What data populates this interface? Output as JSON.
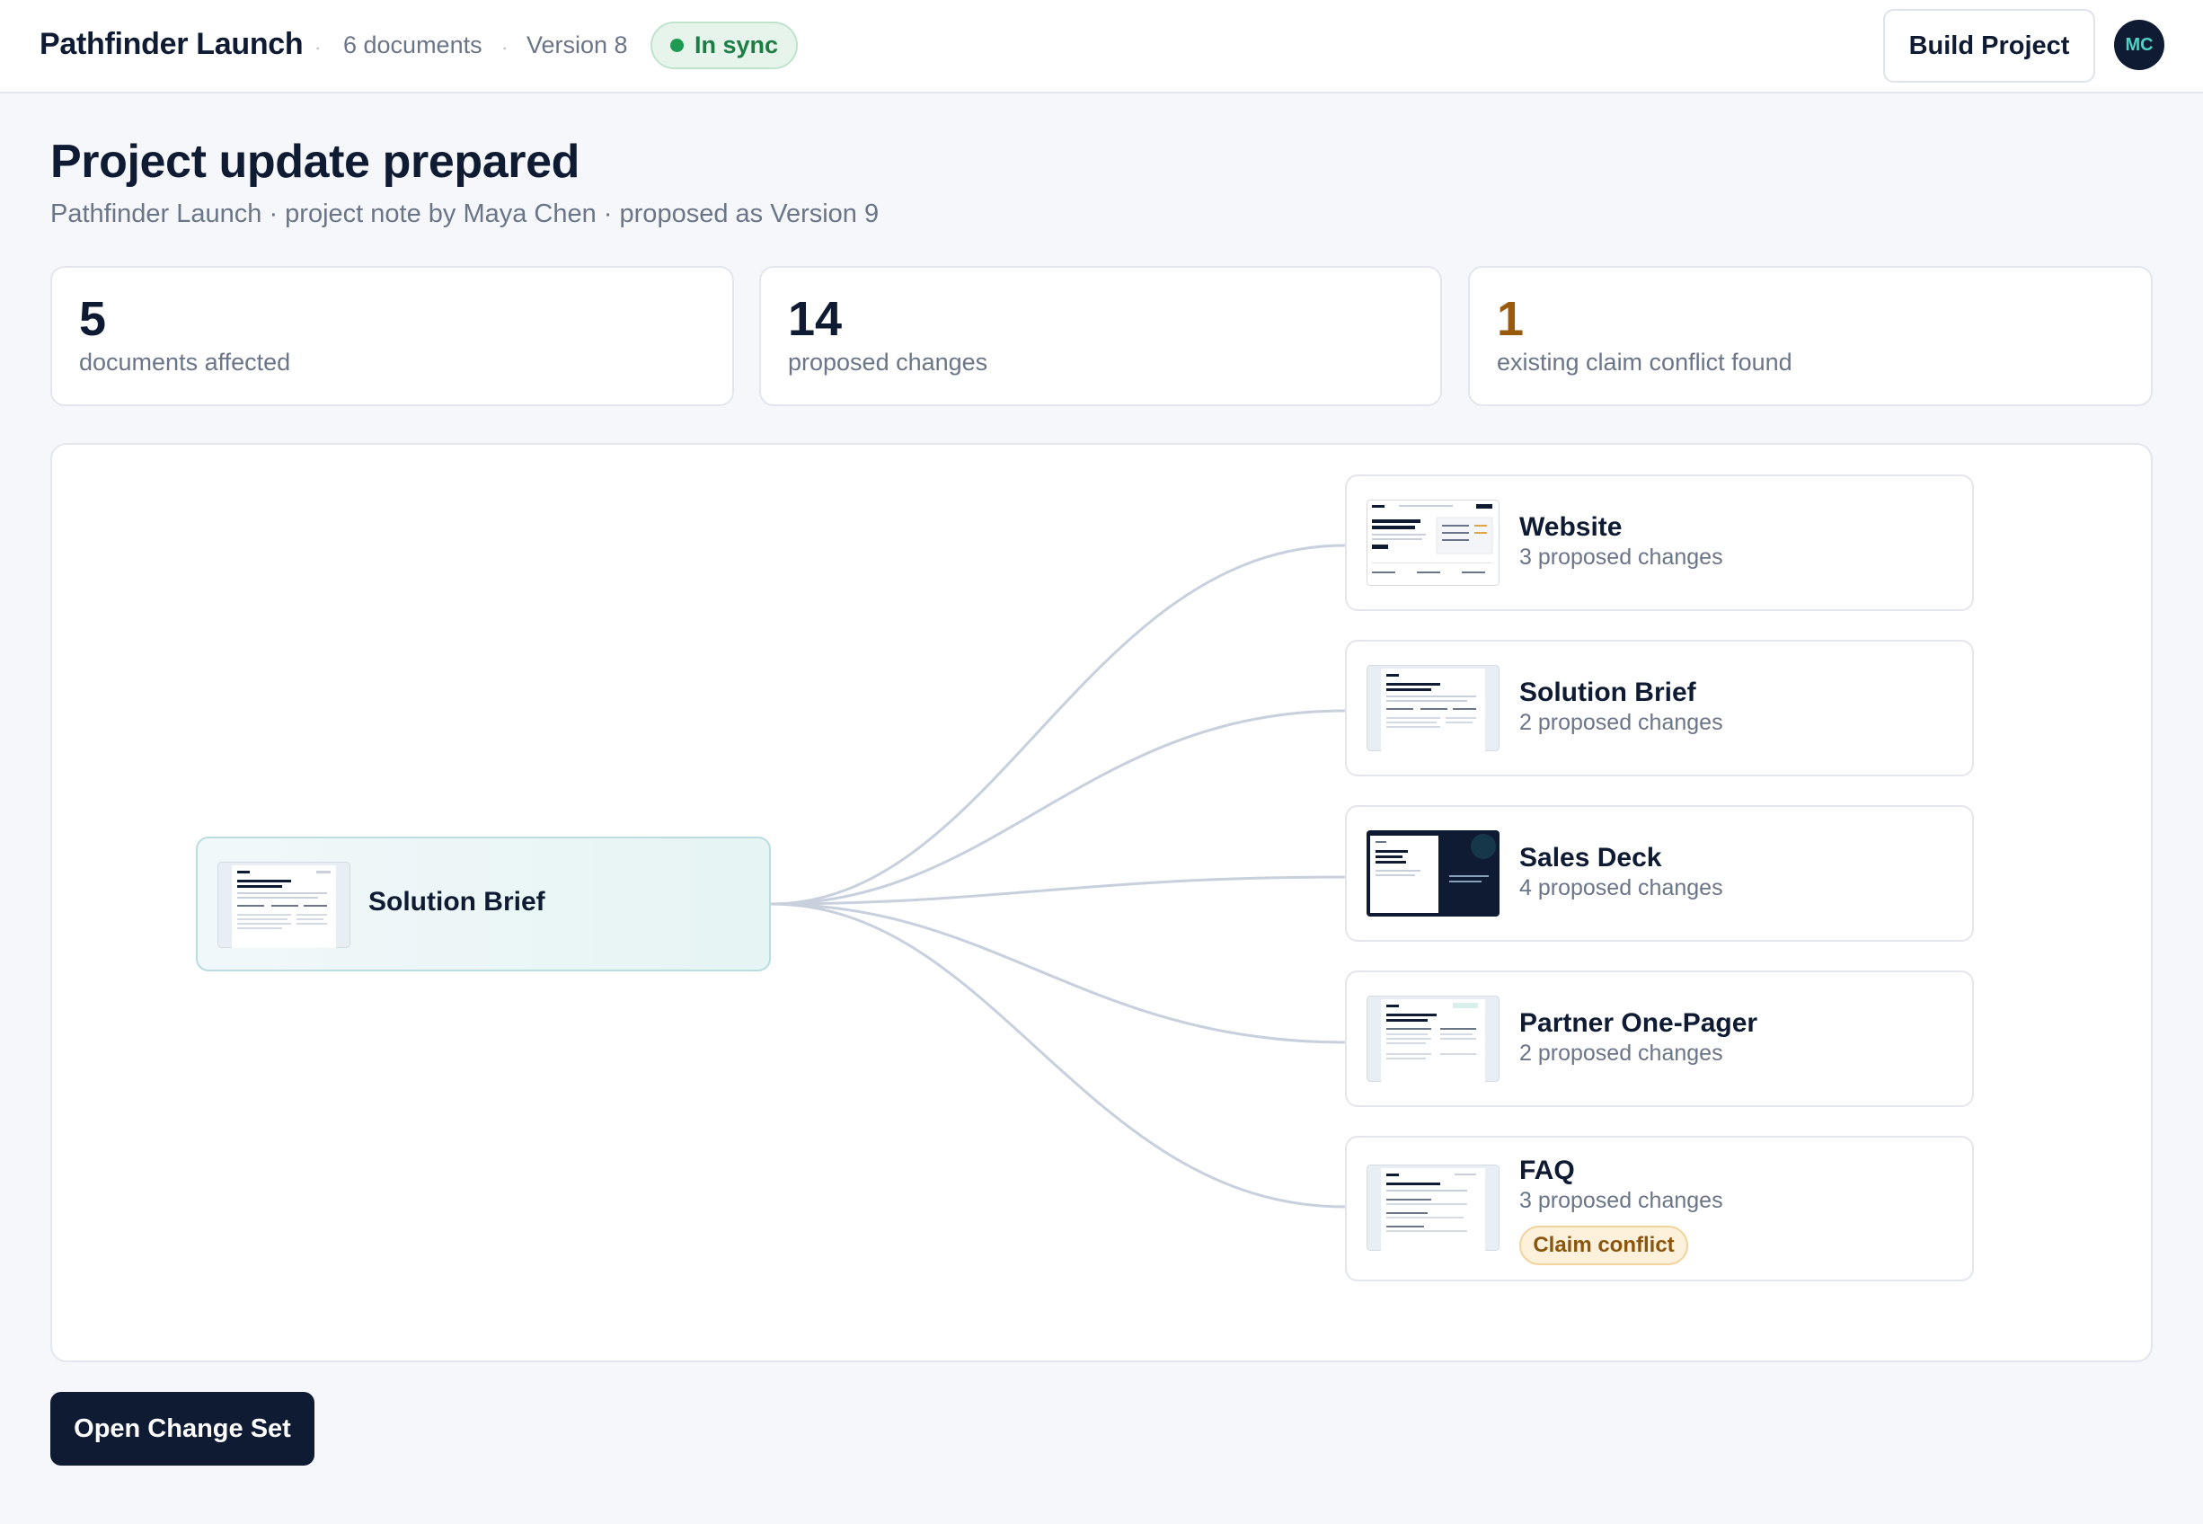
{
  "header": {
    "project_name": "Pathfinder Launch",
    "documents_count": "6 documents",
    "version": "Version 8",
    "sync_status": "In sync",
    "build_button": "Build Project",
    "avatar_initials": "MC"
  },
  "main": {
    "title": "Project update prepared",
    "subtitle": "Pathfinder Launch · project note by Maya Chen · proposed as Version 9"
  },
  "stats": [
    {
      "value": "5",
      "label": "documents affected"
    },
    {
      "value": "14",
      "label": "proposed changes"
    },
    {
      "value": "1",
      "label": "existing claim conflict found",
      "color": "#9a5a0c"
    }
  ],
  "graph": {
    "source": {
      "title": "Solution Brief",
      "thumb_icon": "brief-thumbnail"
    },
    "targets": [
      {
        "title": "Website",
        "changes": "3 proposed changes",
        "thumb_icon": "website-thumbnail"
      },
      {
        "title": "Solution Brief",
        "changes": "2 proposed changes",
        "thumb_icon": "brief-thumbnail"
      },
      {
        "title": "Sales Deck",
        "changes": "4 proposed changes",
        "thumb_icon": "deck-thumbnail"
      },
      {
        "title": "Partner One-Pager",
        "changes": "2 proposed changes",
        "thumb_icon": "onepager-thumbnail"
      },
      {
        "title": "FAQ",
        "changes": "3 proposed changes",
        "badge": "Claim conflict",
        "thumb_icon": "faq-thumbnail"
      }
    ]
  },
  "footer": {
    "open_button": "Open Change Set"
  },
  "colors": {
    "navy": "#0f1b33",
    "sync_green": "#1e7c45",
    "conflict_amber": "#9a5a0c",
    "edge": "#c7d0dc",
    "source_tint": "#e6f4f3"
  }
}
